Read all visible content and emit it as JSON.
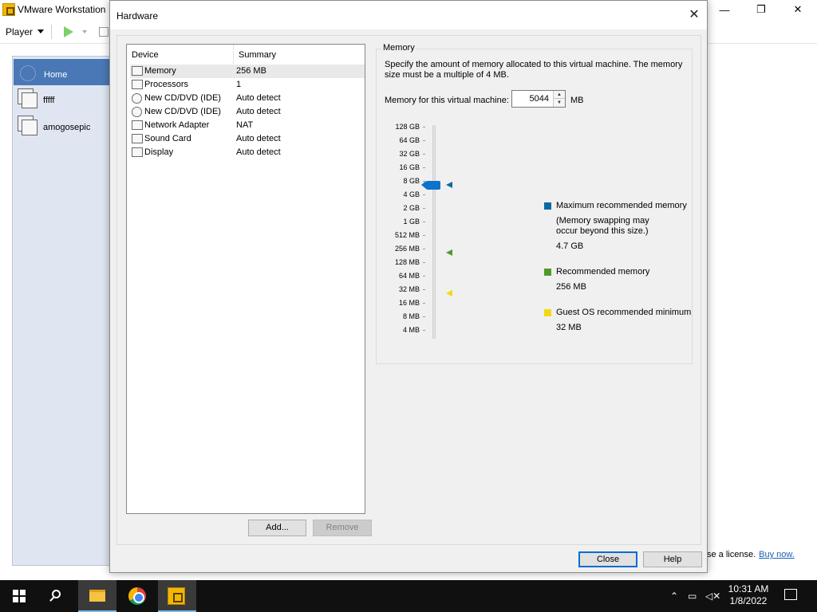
{
  "background_window": {
    "title": "VMware Workstation",
    "controls": {
      "minimize": "—",
      "maximize": "❐",
      "close": "✕"
    },
    "toolbar": {
      "player_label": "Player"
    },
    "library": {
      "home_label": "Home",
      "vms": [
        "fffff",
        "amogosepic"
      ]
    },
    "license_text": "se a license.",
    "buy_now": "Buy now."
  },
  "dialog": {
    "title": "Hardware",
    "close_glyph": "✕",
    "device_list": {
      "headers": {
        "device": "Device",
        "summary": "Summary"
      },
      "rows": [
        {
          "name": "Memory",
          "summary": "256 MB",
          "icon": "memory-icon",
          "selected": true
        },
        {
          "name": "Processors",
          "summary": "1",
          "icon": "processor-icon"
        },
        {
          "name": "New CD/DVD (IDE)",
          "summary": "Auto detect",
          "icon": "cd-icon"
        },
        {
          "name": "New CD/DVD (IDE)",
          "summary": "Auto detect",
          "icon": "cd-icon"
        },
        {
          "name": "Network Adapter",
          "summary": "NAT",
          "icon": "network-icon"
        },
        {
          "name": "Sound Card",
          "summary": "Auto detect",
          "icon": "speaker-icon"
        },
        {
          "name": "Display",
          "summary": "Auto detect",
          "icon": "monitor-icon"
        }
      ]
    },
    "add_button": "Add...",
    "remove_button": "Remove",
    "memory": {
      "group_label": "Memory",
      "description": "Specify the amount of memory allocated to this virtual machine. The memory size must be a multiple of 4 MB.",
      "field_label": "Memory for this virtual machine:",
      "value": "5044",
      "unit": "MB",
      "scale_labels": [
        "128 GB",
        "64 GB",
        "32 GB",
        "16 GB",
        "8 GB",
        "4 GB",
        "2 GB",
        "1 GB",
        "512 MB",
        "256 MB",
        "128 MB",
        "64 MB",
        "32 MB",
        "16 MB",
        "8 MB",
        "4 MB"
      ],
      "legend": {
        "max_title": "Maximum recommended memory",
        "max_note": "(Memory swapping may\noccur beyond this size.)",
        "max_value": "4.7 GB",
        "rec_title": "Recommended memory",
        "rec_value": "256 MB",
        "min_title": "Guest OS recommended minimum",
        "min_value": "32 MB"
      },
      "colors": {
        "max": "#0b6aa3",
        "recommended": "#4f9a2a",
        "minimum": "#f5d80f",
        "thumb": "#0b73c9"
      }
    },
    "close_button": "Close",
    "help_button": "Help"
  },
  "taskbar": {
    "time": "10:31 AM",
    "date": "1/8/2022",
    "tray_icons": [
      "chevron-up-icon",
      "network-icon",
      "volume-muted-icon"
    ]
  }
}
